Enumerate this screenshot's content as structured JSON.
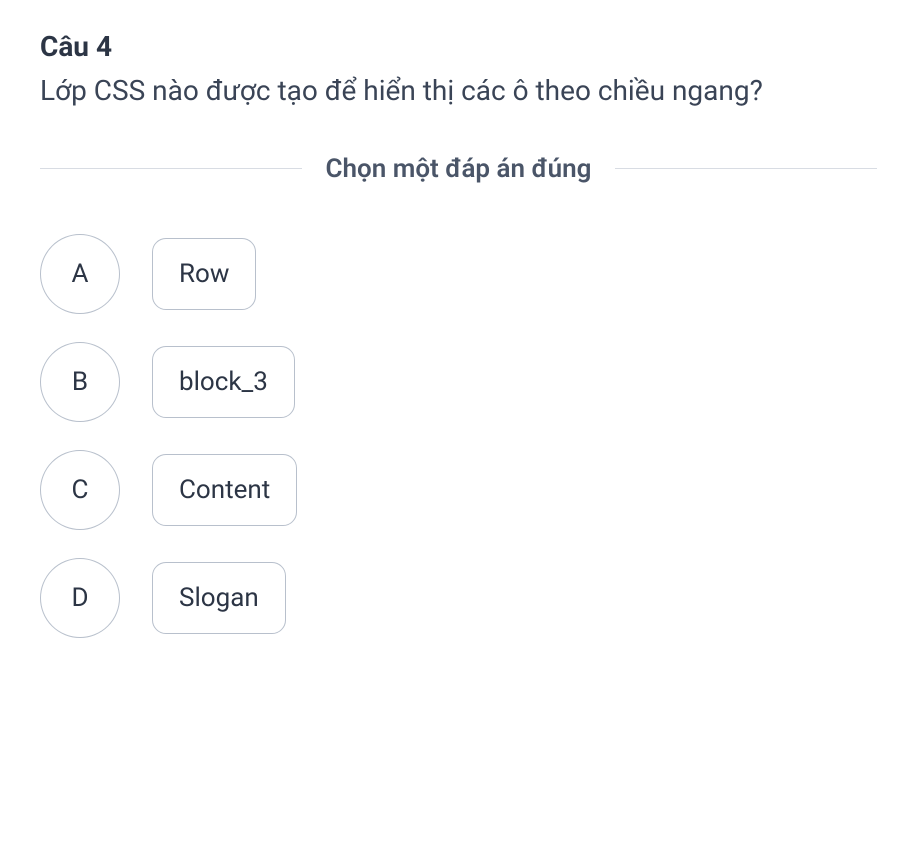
{
  "question": {
    "number_label": "Câu 4",
    "text": "Lớp CSS nào được tạo để hiển thị các ô theo chiều ngang?"
  },
  "instruction": "Chọn một đáp án đúng",
  "options": [
    {
      "letter": "A",
      "text": "Row"
    },
    {
      "letter": "B",
      "text": "block_3"
    },
    {
      "letter": "C",
      "text": "Content"
    },
    {
      "letter": "D",
      "text": "Slogan"
    }
  ]
}
